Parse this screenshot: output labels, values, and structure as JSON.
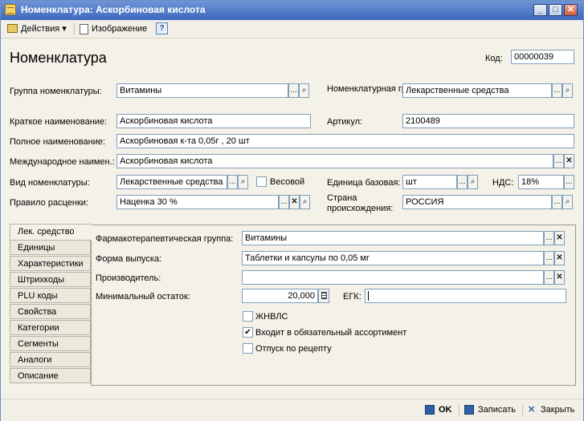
{
  "window": {
    "title": "Номенклатура: Аскорбиновая кислота",
    "minimize": "_",
    "maximize": "□",
    "close": "✕"
  },
  "toolbar": {
    "actions": "Действия",
    "image": "Изображение",
    "help": "?"
  },
  "form": {
    "heading": "Номенклатура",
    "code_label": "Код:",
    "code_value": "00000039",
    "group_label": "Группа номенклатуры:",
    "group_value": "Витамины",
    "nom_group_label": "Номенклатурная группа:",
    "nom_group_value": "Лекарственные средства",
    "short_name_label": "Краткое наименование:",
    "short_name_value": "Аскорбиновая кислота",
    "article_label": "Артикул:",
    "article_value": "2100489",
    "full_name_label": "Полное наименование:",
    "full_name_value": "Аскорбиновая к-та 0,05г , 20 шт",
    "intl_name_label": "Международное наимен.:",
    "intl_name_value": "Аскорбиновая кислота",
    "kind_label": "Вид номенклатуры:",
    "kind_value": "Лекарственные средства",
    "weight_label": "Весовой",
    "unit_label": "Единица базовая:",
    "unit_value": "шт",
    "vat_label": "НДС:",
    "vat_value": "18%",
    "price_rule_label": "Правило расценки:",
    "price_rule_value": "Наценка 30 %",
    "country_label": "Страна происхождения:",
    "country_value": "РОССИЯ"
  },
  "tabs": [
    {
      "label": "Лек. средство",
      "active": true
    },
    {
      "label": "Единицы"
    },
    {
      "label": "Характеристики"
    },
    {
      "label": "Штрихкоды"
    },
    {
      "label": "PLU коды"
    },
    {
      "label": "Свойства"
    },
    {
      "label": "Категории"
    },
    {
      "label": "Сегменты"
    },
    {
      "label": "Аналоги"
    },
    {
      "label": "Описание"
    }
  ],
  "drug": {
    "pharm_group_label": "Фармакотерапевтическая группа:",
    "pharm_group_value": "Витамины",
    "release_form_label": "Форма выпуска:",
    "release_form_value": "Таблетки и капсулы по 0,05 мг",
    "manufacturer_label": "Производитель:",
    "manufacturer_value": "",
    "min_stock_label": "Минимальный остаток:",
    "min_stock_value": "20,000",
    "egk_label": "ЕГК:",
    "egk_value": "",
    "zhnvls_label": "ЖНВЛС",
    "zhnvls_checked": false,
    "assortment_label": "Входит в обязательный ассортимент",
    "assortment_checked": true,
    "prescription_label": "Отпуск по рецепту",
    "prescription_checked": false
  },
  "bottom": {
    "ok": "OK",
    "save": "Записать",
    "close": "Закрыть"
  },
  "glyphs": {
    "dots": "...",
    "clear": "✕",
    "check": "✔",
    "search": "⌕"
  },
  "colors": {
    "titlebar": "#3d68bf",
    "panel": "#f4f1e8",
    "border": "#7f9db9"
  }
}
